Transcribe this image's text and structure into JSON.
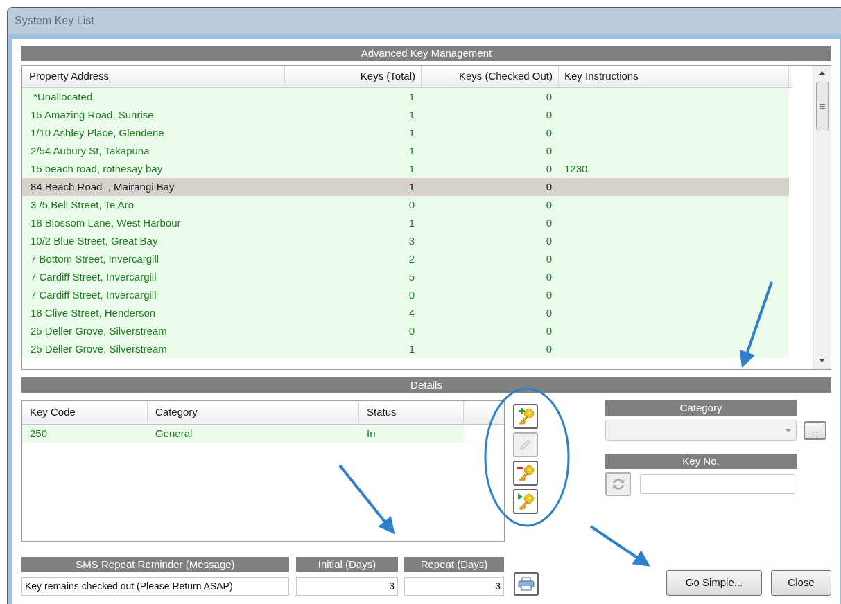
{
  "window": {
    "title": "System Key List"
  },
  "key_list": {
    "header": "Advanced Key Management",
    "columns": [
      "Property Address",
      "Keys (Total)",
      "Keys (Checked Out)",
      "Key Instructions"
    ],
    "rows": [
      {
        "address": " *Unallocated,",
        "total": "1",
        "checked_out": "0",
        "instructions": "",
        "selected": false
      },
      {
        "address": "15 Amazing Road, Sunrise",
        "total": "1",
        "checked_out": "0",
        "instructions": "",
        "selected": false
      },
      {
        "address": "1/10 Ashley Place, Glendene",
        "total": "1",
        "checked_out": "0",
        "instructions": "",
        "selected": false
      },
      {
        "address": "2/54 Aubury St, Takapuna",
        "total": "1",
        "checked_out": "0",
        "instructions": "",
        "selected": false
      },
      {
        "address": "15 beach road, rothesay bay",
        "total": "1",
        "checked_out": "0",
        "instructions": "1230.",
        "selected": false
      },
      {
        "address": "84 Beach Road  , Mairangi Bay",
        "total": "1",
        "checked_out": "0",
        "instructions": "",
        "selected": true
      },
      {
        "address": "3 /5 Bell Street, Te Aro",
        "total": "0",
        "checked_out": "0",
        "instructions": "",
        "selected": false
      },
      {
        "address": "18 Blossom Lane, West Harbour",
        "total": "1",
        "checked_out": "0",
        "instructions": "",
        "selected": false
      },
      {
        "address": "10/2 Blue Street, Great Bay",
        "total": "3",
        "checked_out": "0",
        "instructions": "",
        "selected": false
      },
      {
        "address": "7 Bottom Street, Invercargill",
        "total": "2",
        "checked_out": "0",
        "instructions": "",
        "selected": false
      },
      {
        "address": "7 Cardiff Street, Invercargill",
        "total": "5",
        "checked_out": "0",
        "instructions": "",
        "selected": false
      },
      {
        "address": "7 Cardiff Street, Invercargill",
        "total": "0",
        "checked_out": "0",
        "instructions": "",
        "selected": false
      },
      {
        "address": "18 Clive Street, Henderson",
        "total": "4",
        "checked_out": "0",
        "instructions": "",
        "selected": false
      },
      {
        "address": "25 Deller Grove, Silverstream",
        "total": "0",
        "checked_out": "0",
        "instructions": "",
        "selected": false
      },
      {
        "address": "25 Deller Grove, Silverstream",
        "total": "1",
        "checked_out": "0",
        "instructions": "",
        "selected": false
      }
    ]
  },
  "details": {
    "header": "Details",
    "columns": [
      "Key Code",
      "Category",
      "Status"
    ],
    "rows": [
      {
        "key_code": "250",
        "category": "General",
        "status": "In"
      }
    ]
  },
  "tools": [
    {
      "kind": "add",
      "disabled": false
    },
    {
      "kind": "edit",
      "disabled": true
    },
    {
      "kind": "remove",
      "disabled": false
    },
    {
      "kind": "checkout",
      "disabled": false
    }
  ],
  "category": {
    "label": "Category",
    "browse": "..."
  },
  "key_no": {
    "label": "Key No.",
    "refresh_disabled": true
  },
  "sms": {
    "label": "SMS Repeat Reminder (Message)",
    "value": "Key remains checked out (Please Return ASAP)"
  },
  "initial": {
    "label": "Initial (Days)",
    "value": "3"
  },
  "repeat": {
    "label": "Repeat (Days)",
    "value": "3"
  },
  "buttons": [
    "Go Simple...",
    "Close"
  ]
}
